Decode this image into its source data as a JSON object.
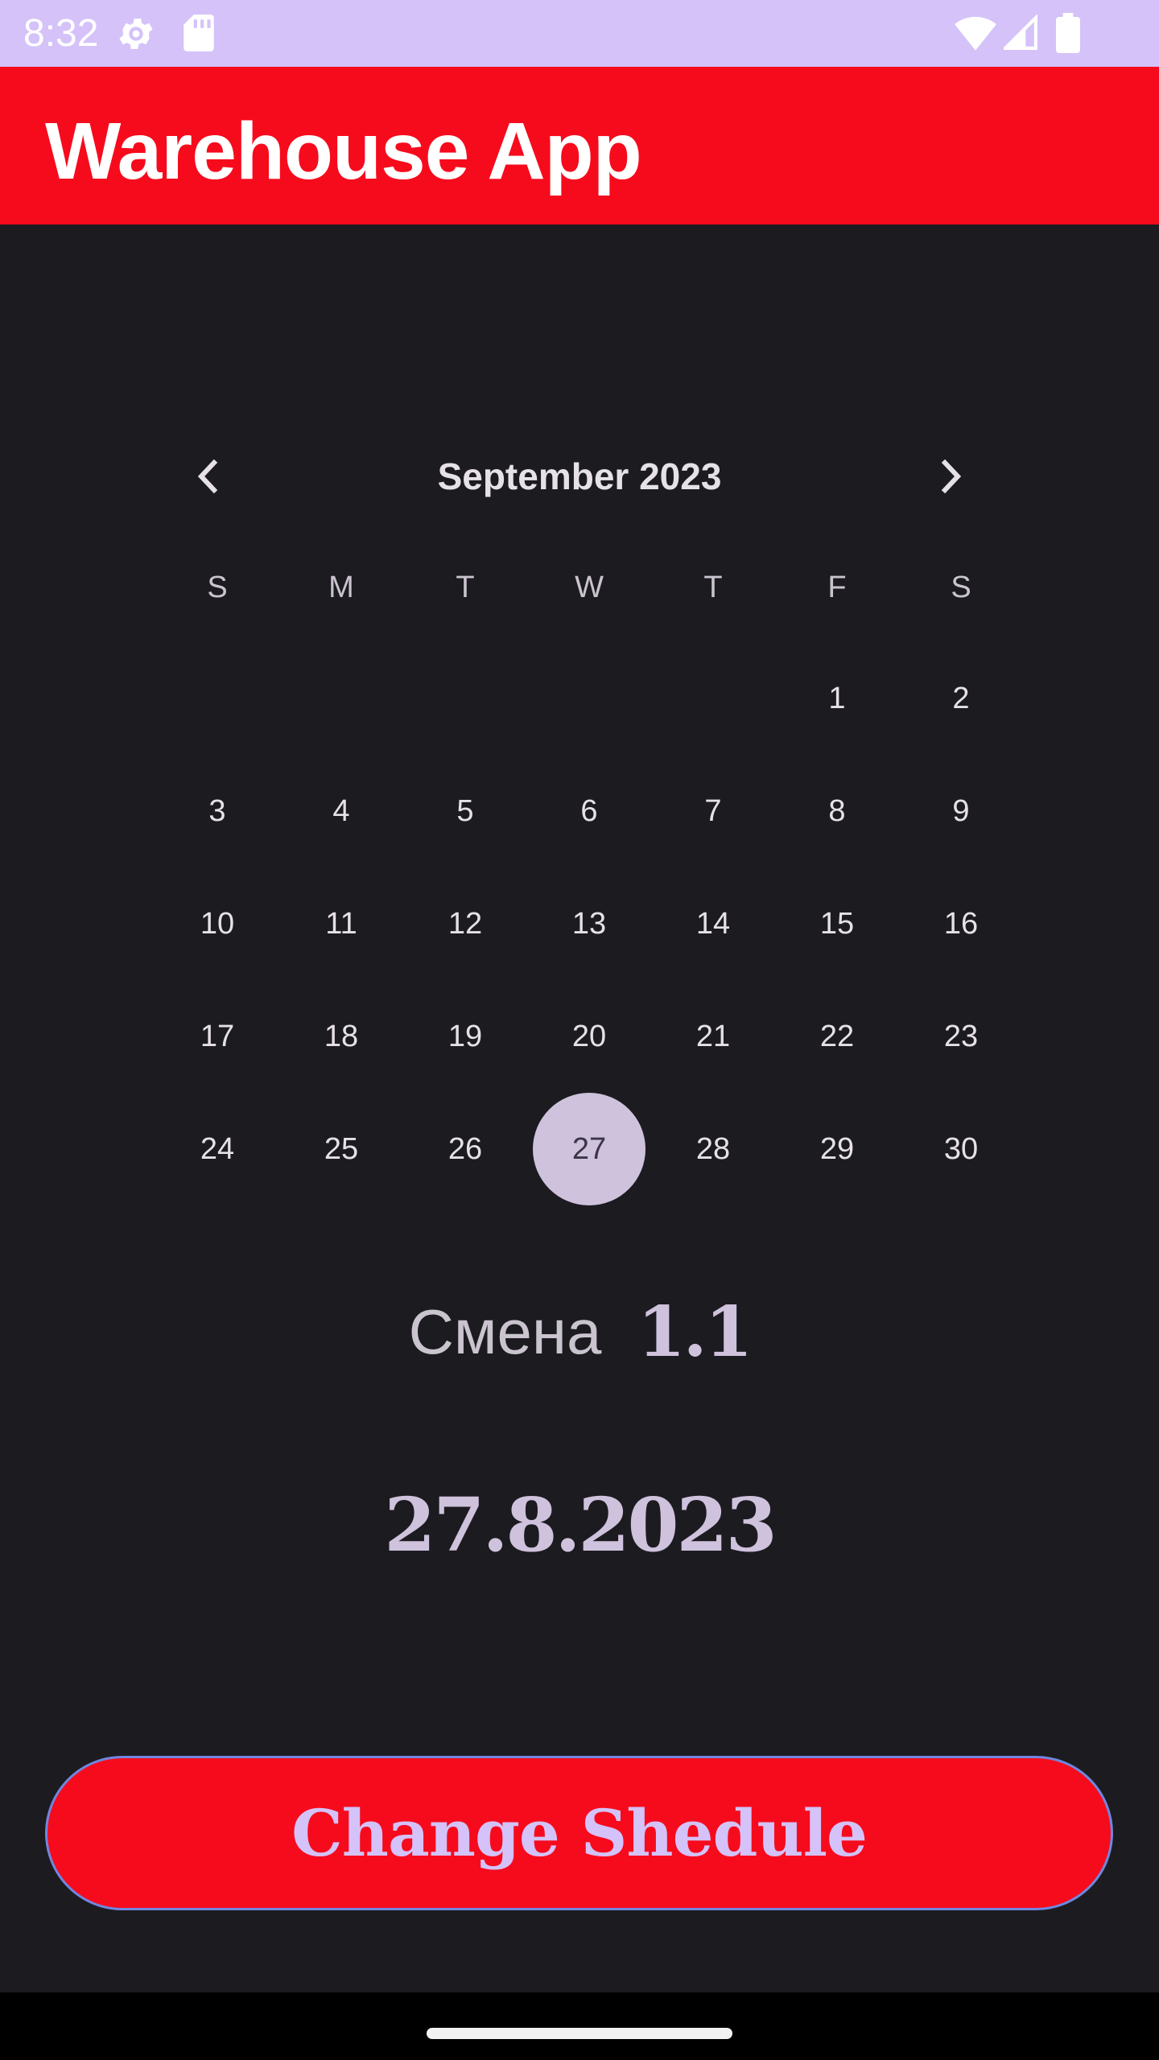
{
  "status_bar": {
    "time": "8:32",
    "icons": [
      "settings-gear-icon",
      "sd-card-icon",
      "wifi-icon",
      "cell-signal-icon",
      "battery-icon"
    ]
  },
  "app_bar": {
    "title": "Warehouse App",
    "background": "#f60b1d"
  },
  "calendar": {
    "month_label": "September 2023",
    "prev_icon": "chevron-left-icon",
    "next_icon": "chevron-right-icon",
    "weekdays": [
      "S",
      "M",
      "T",
      "W",
      "T",
      "F",
      "S"
    ],
    "first_weekday_index": 5,
    "days": [
      "1",
      "2",
      "3",
      "4",
      "5",
      "6",
      "7",
      "8",
      "9",
      "10",
      "11",
      "12",
      "13",
      "14",
      "15",
      "16",
      "17",
      "18",
      "19",
      "20",
      "21",
      "22",
      "23",
      "24",
      "25",
      "26",
      "27",
      "28",
      "29",
      "30"
    ],
    "selected_day": "27",
    "selected_color": "#cfc2dd"
  },
  "shift": {
    "label": "Смена",
    "value": "1.1"
  },
  "date_display": "27.8.2023",
  "change_button": {
    "label": "Change Shedule",
    "background": "#f60b1d",
    "text_color": "#d4c2f9"
  }
}
